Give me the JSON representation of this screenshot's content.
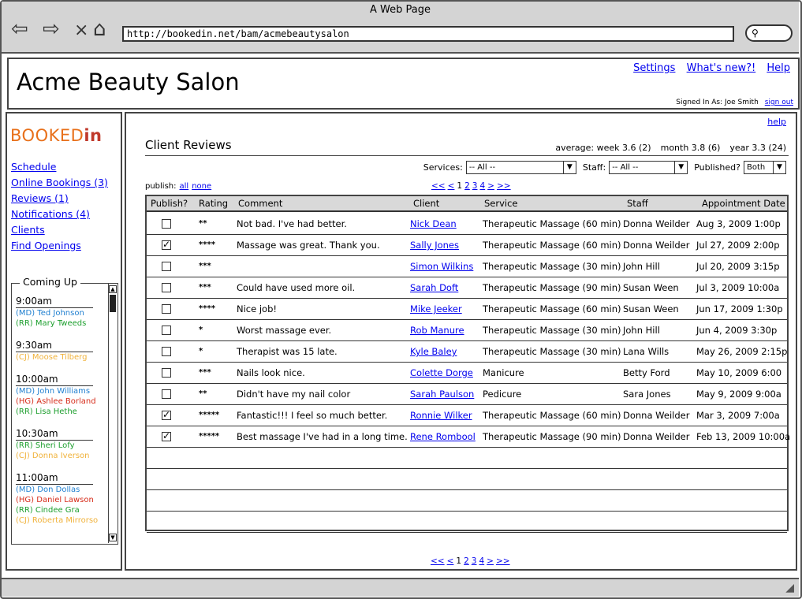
{
  "browser": {
    "window_title": "A Web Page",
    "url": "http://bookedin.net/bam/acmebeautysalon",
    "icons": {
      "back": "back-arrow-icon",
      "forward": "forward-arrow-icon",
      "stop": "stop-icon",
      "home": "home-icon",
      "search": "search-icon"
    }
  },
  "header": {
    "title": "Acme Beauty Salon",
    "links": {
      "settings": "Settings",
      "whats_new": "What's new?!",
      "help": "Help"
    },
    "signed_in_as": "Signed In As: Joe Smith",
    "sign_out": "sign out"
  },
  "sidebar": {
    "logo_booked": "BOOKED",
    "logo_in": "in",
    "nav": {
      "schedule": "Schedule",
      "online_bookings": "Online Bookings (3)",
      "reviews": "Reviews (1)",
      "notifications": "Notifications (4)",
      "clients": "Clients",
      "find_openings": "Find Openings"
    },
    "coming_up": {
      "title": "Coming Up",
      "slots": [
        {
          "time": "9:00am",
          "entries": [
            {
              "text": "(MD) Ted Johnson",
              "color": "#1f7fd0"
            },
            {
              "text": "(RR) Mary Tweeds",
              "color": "#1b9e2c"
            }
          ]
        },
        {
          "time": "9:30am",
          "entries": [
            {
              "text": "(CJ) Moose Tilberg",
              "color": "#f0b23a"
            }
          ]
        },
        {
          "time": "10:00am",
          "entries": [
            {
              "text": "(MD) John Williams",
              "color": "#1f7fd0"
            },
            {
              "text": "(HG) Ashlee Borland",
              "color": "#d62c1a"
            },
            {
              "text": "(RR) Lisa Hethe",
              "color": "#1b9e2c"
            }
          ]
        },
        {
          "time": "10:30am",
          "entries": [
            {
              "text": "(RR) Sheri Lofy",
              "color": "#1b9e2c"
            },
            {
              "text": "(CJ) Donna Iverson",
              "color": "#f0b23a"
            }
          ]
        },
        {
          "time": "11:00am",
          "entries": [
            {
              "text": "(MD) Don Dollas",
              "color": "#1f7fd0"
            },
            {
              "text": "(HG) Daniel Lawson",
              "color": "#d62c1a"
            },
            {
              "text": "(RR) Cindee Gra",
              "color": "#1b9e2c"
            },
            {
              "text": "(CJ) Roberta Mirrorso",
              "color": "#f0b23a"
            }
          ]
        }
      ]
    }
  },
  "main": {
    "help": "help",
    "heading": "Client Reviews",
    "averages": {
      "week": "average: week 3.6 (2)",
      "month": "month 3.8 (6)",
      "year": "year 3.3 (24)"
    },
    "filters": {
      "services_label": "Services:",
      "services_value": "-- All --",
      "staff_label": "Staff:",
      "staff_value": "-- All --",
      "published_label": "Published?",
      "published_value": "Both"
    },
    "publish_filter": {
      "label": "publish:",
      "all": "all",
      "none": "none"
    },
    "pager": {
      "first": "<<",
      "prev": "<",
      "current": "1",
      "p2": "2",
      "p3": "3",
      "p4": "4",
      "next": ">",
      "last": ">>"
    },
    "columns": {
      "publish": "Publish?",
      "rating": "Rating",
      "comment": "Comment",
      "client": "Client",
      "service": "Service",
      "staff": "Staff",
      "date": "Appointment Date"
    },
    "rows": [
      {
        "published": false,
        "rating": "**",
        "comment": "Not bad. I've had better.",
        "client": "Nick Dean",
        "service": "Therapeutic Massage (60 min)",
        "staff": "Donna Weilder",
        "date": "Aug 3, 2009 1:00p"
      },
      {
        "published": true,
        "rating": "****",
        "comment": "Massage was great. Thank you.",
        "client": "Sally Jones",
        "service": "Therapeutic Massage (60 min)",
        "staff": "Donna Weilder",
        "date": "Jul 27, 2009 2:00p"
      },
      {
        "published": false,
        "rating": "***",
        "comment": "",
        "client": "Simon Wilkins",
        "service": "Therapeutic Massage (30 min)",
        "staff": "John Hill",
        "date": "Jul 20, 2009 3:15p"
      },
      {
        "published": false,
        "rating": "***",
        "comment": "Could have used more oil.",
        "client": "Sarah Doft",
        "service": "Therapeutic Massage (90 min)",
        "staff": "Susan Ween",
        "date": "Jul 3, 2009 10:00a"
      },
      {
        "published": false,
        "rating": "****",
        "comment": "Nice job!",
        "client": "Mike Jeeker",
        "service": "Therapeutic Massage (60 min)",
        "staff": "Susan Ween",
        "date": "Jun 17, 2009 1:30p"
      },
      {
        "published": false,
        "rating": "*",
        "comment": "Worst massage ever.",
        "client": "Rob Manure",
        "service": "Therapeutic Massage (30 min)",
        "staff": "John Hill",
        "date": "Jun 4, 2009 3:30p"
      },
      {
        "published": false,
        "rating": "*",
        "comment": "Therapist was 15 late.",
        "client": "Kyle Baley",
        "service": "Therapeutic Massage (30 min)",
        "staff": "Lana Wills",
        "date": "May 26, 2009 2:15p"
      },
      {
        "published": false,
        "rating": "***",
        "comment": "Nails look nice.",
        "client": "Colette Dorge",
        "service": "Manicure",
        "staff": "Betty Ford",
        "date": "May 10, 2009 6:00"
      },
      {
        "published": false,
        "rating": "**",
        "comment": "Didn't have my nail color",
        "client": "Sarah Paulson",
        "service": "Pedicure",
        "staff": "Sara Jones",
        "date": "May 9, 2009 9:00a"
      },
      {
        "published": true,
        "rating": "*****",
        "comment": "Fantastic!!! I feel so much better.",
        "client": "Ronnie Wilker",
        "service": "Therapeutic Massage (60 min)",
        "staff": "Donna Weilder",
        "date": "Mar 3, 2009 7:00a"
      },
      {
        "published": true,
        "rating": "*****",
        "comment": "Best massage I've had in a long time.",
        "client": "Rene Rombool",
        "service": "Therapeutic Massage (90 min)",
        "staff": "Donna Weilder",
        "date": "Feb 13, 2009 10:00a"
      }
    ]
  }
}
